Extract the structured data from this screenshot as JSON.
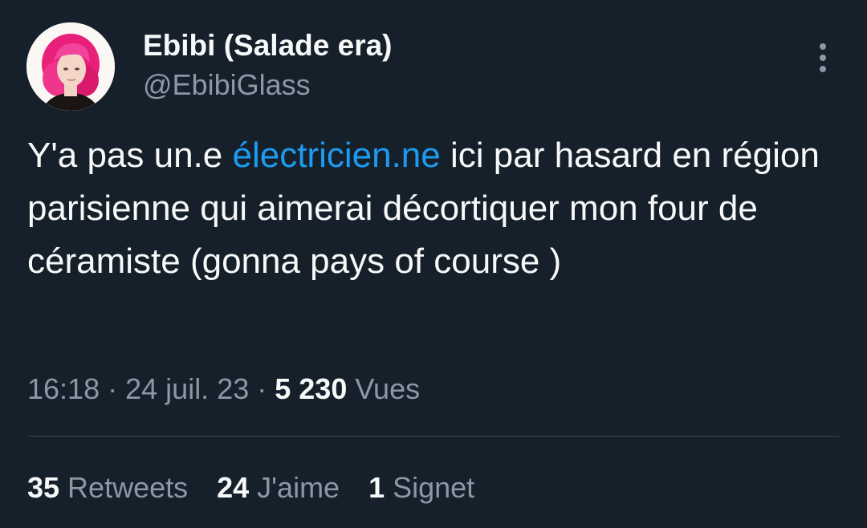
{
  "author": {
    "display_name": "Ebibi (Salade era)",
    "handle": "@EbibiGlass"
  },
  "menu": {
    "icon": "more-vertical-icon"
  },
  "tweet": {
    "text_before": "Y'a pas un.e ",
    "link_text": "électricien.ne",
    "text_after": " ici par hasard en région parisienne qui aimerai décortiquer mon four de céramiste (gonna pays of course )"
  },
  "meta": {
    "time": "16:18",
    "separator": "·",
    "date": "24 juil. 23",
    "views_count": "5 230",
    "views_label": "Vues"
  },
  "stats": {
    "retweets_count": "35",
    "retweets_label": "Retweets",
    "likes_count": "24",
    "likes_label": "J'aime",
    "bookmarks_count": "1",
    "bookmarks_label": "Signet"
  },
  "colors": {
    "background": "#15202b",
    "text": "#f7f9f9",
    "secondary": "#8b98a5",
    "link": "#1d9bf0"
  }
}
